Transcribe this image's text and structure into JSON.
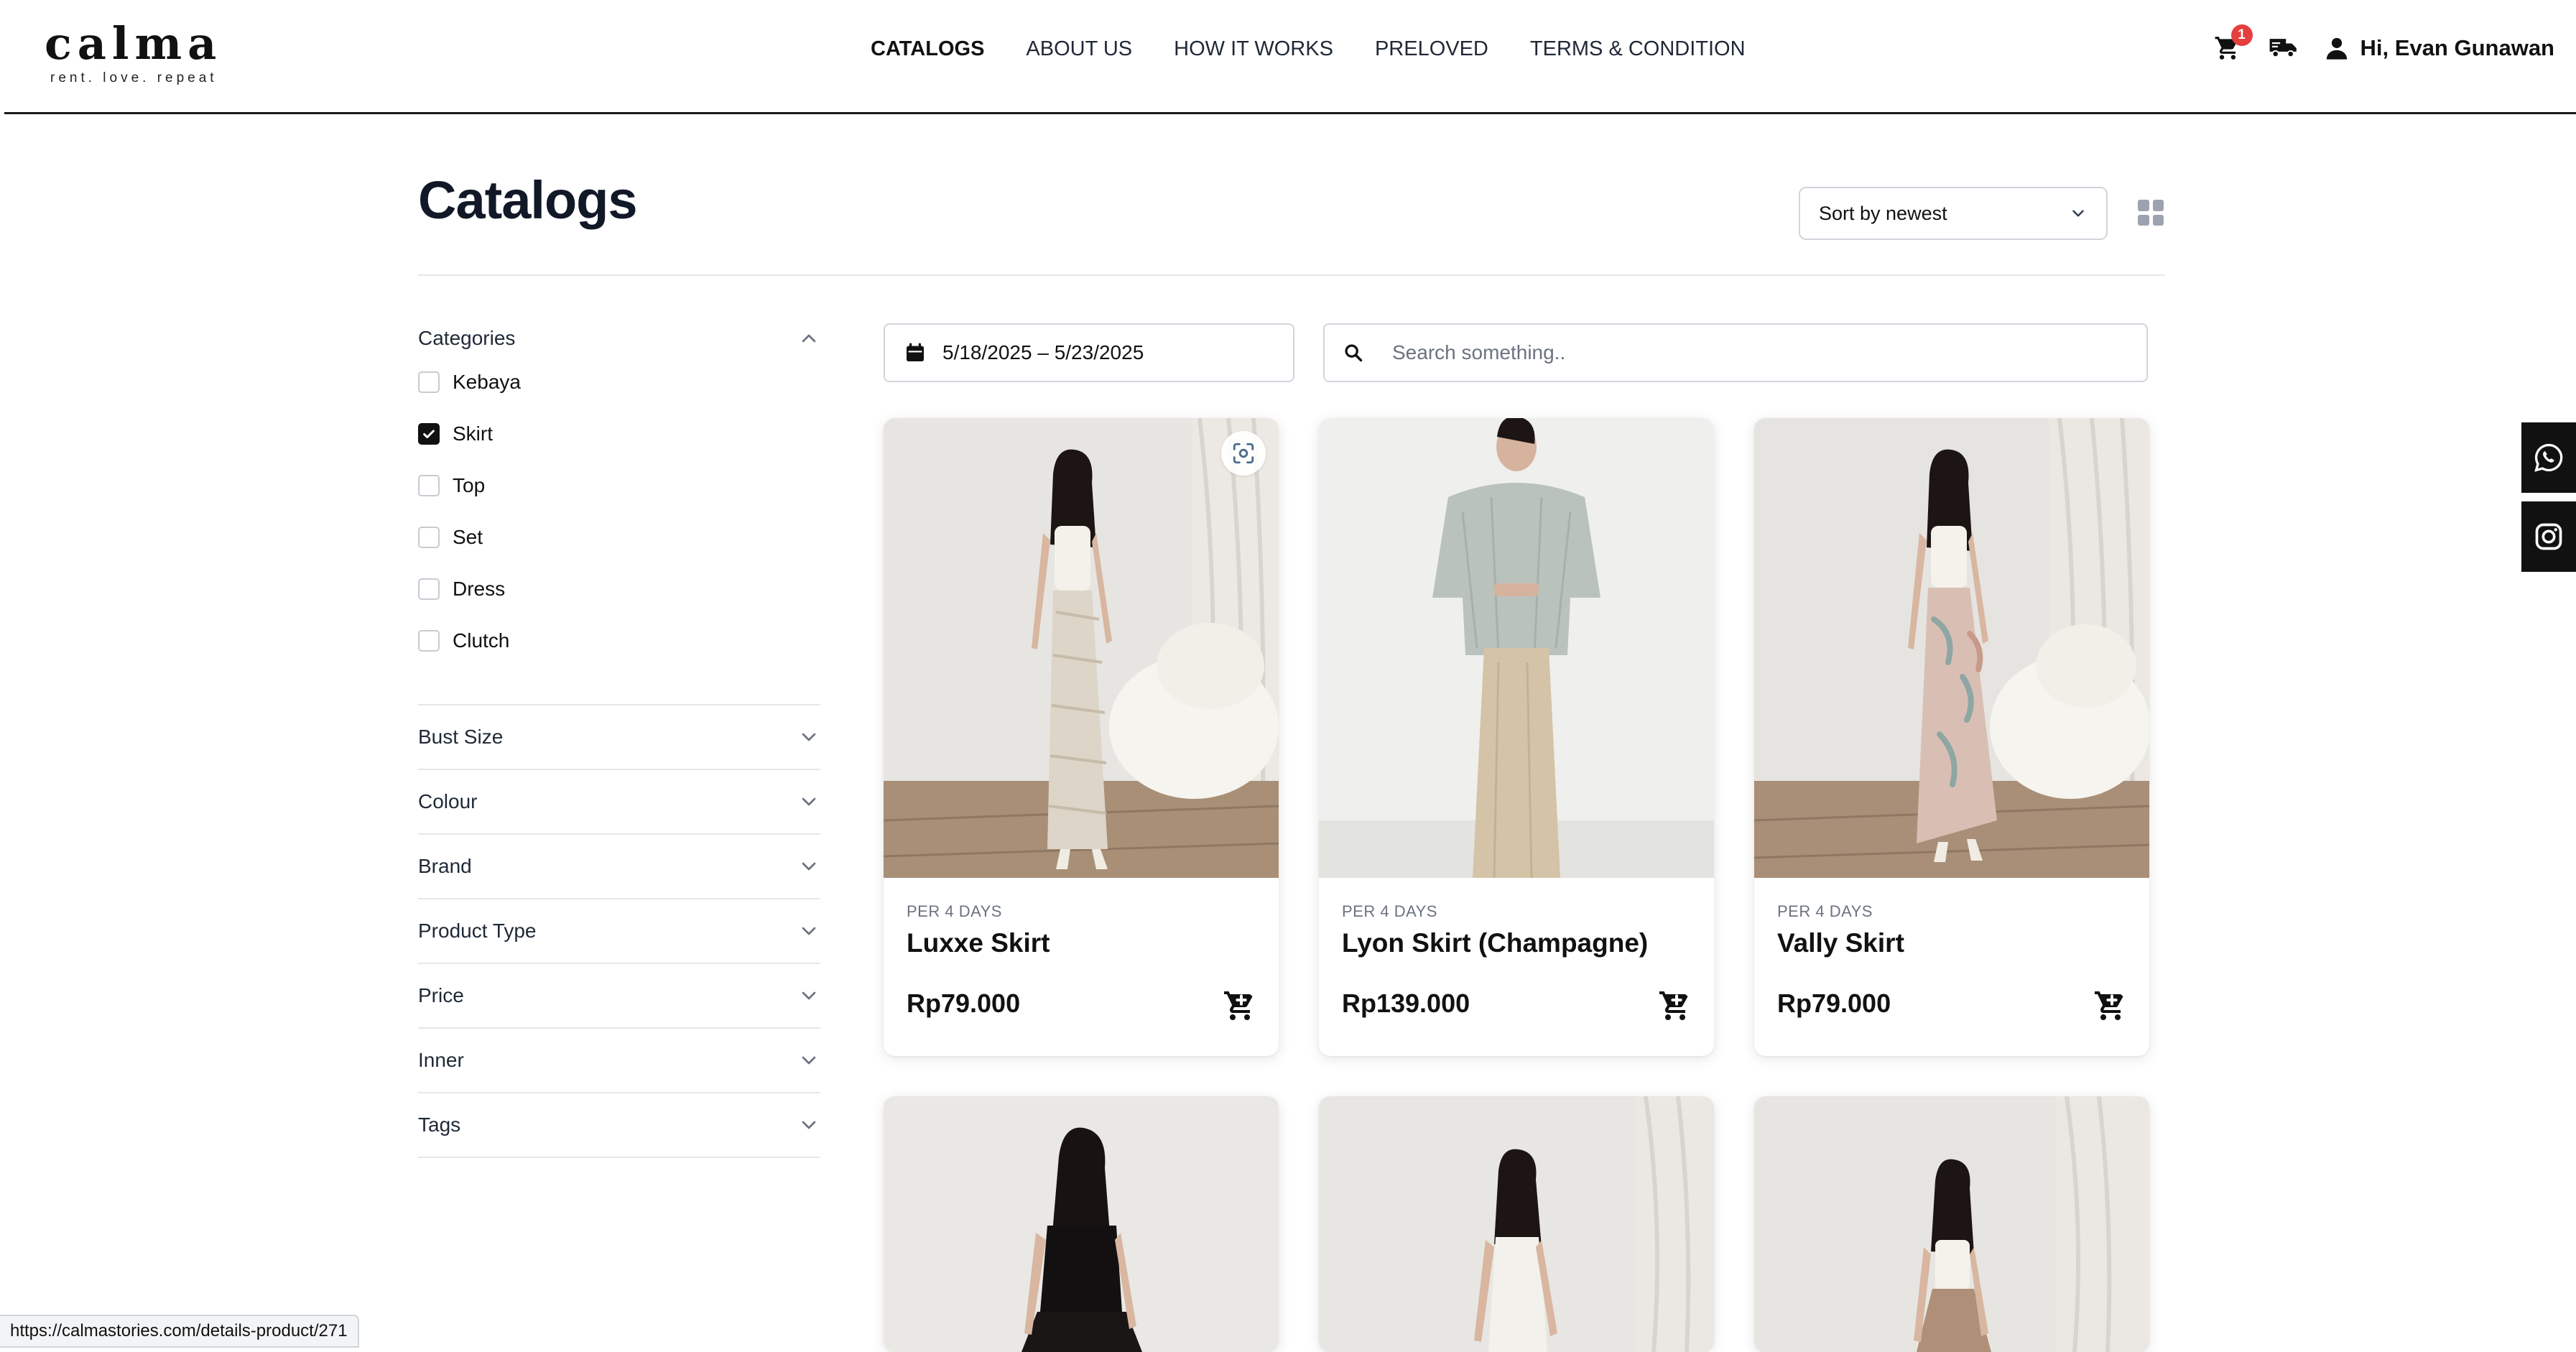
{
  "brand": {
    "name": "calma",
    "tagline": "rent. love. repeat"
  },
  "nav": {
    "items": [
      {
        "label": "CATALOGS",
        "active": true
      },
      {
        "label": "ABOUT US",
        "active": false
      },
      {
        "label": "HOW IT WORKS",
        "active": false
      },
      {
        "label": "PRELOVED",
        "active": false
      },
      {
        "label": "TERMS & CONDITION",
        "active": false
      }
    ]
  },
  "header_right": {
    "cart_count": "1",
    "greeting": "Hi, Evan Gunawan",
    "icons": [
      "cart-icon",
      "delivery-truck-icon",
      "user-icon"
    ]
  },
  "page": {
    "title": "Catalogs",
    "sort_label": "Sort by newest"
  },
  "filters": {
    "categories_title": "Categories",
    "categories": [
      {
        "label": "Kebaya",
        "checked": false
      },
      {
        "label": "Skirt",
        "checked": true
      },
      {
        "label": "Top",
        "checked": false
      },
      {
        "label": "Set",
        "checked": false
      },
      {
        "label": "Dress",
        "checked": false
      },
      {
        "label": "Clutch",
        "checked": false
      }
    ],
    "sections": [
      "Bust Size",
      "Colour",
      "Brand",
      "Product Type",
      "Price",
      "Inner",
      "Tags"
    ]
  },
  "date_range": "5/18/2025 – 5/23/2025",
  "search": {
    "placeholder": "Search something..",
    "value": ""
  },
  "products": [
    {
      "period": "PER 4 DAYS",
      "name": "Luxxe Skirt",
      "price": "Rp79.000"
    },
    {
      "period": "PER 4 DAYS",
      "name": "Lyon Skirt (Champagne)",
      "price": "Rp139.000"
    },
    {
      "period": "PER 4 DAYS",
      "name": "Vally Skirt",
      "price": "Rp79.000"
    }
  ],
  "status_bar": {
    "url": "https://calmastories.com/details-product/271"
  },
  "colors": {
    "accent": "#111111",
    "badge": "#e53e3e",
    "border": "#d1d5db"
  }
}
